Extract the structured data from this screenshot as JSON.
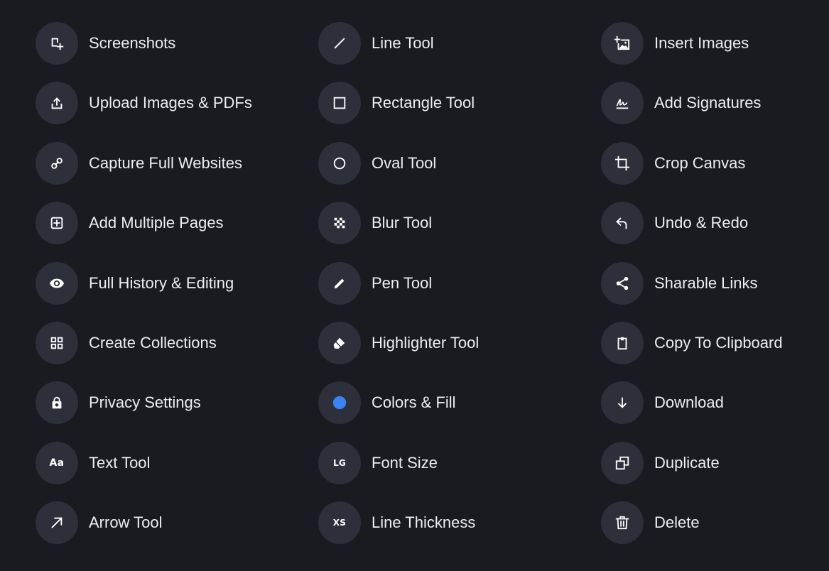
{
  "features": {
    "columns": [
      {
        "items": [
          {
            "label": "Screenshots",
            "icon": "screenshot-icon"
          },
          {
            "label": "Upload Images & PDFs",
            "icon": "upload-icon"
          },
          {
            "label": "Capture Full Websites",
            "icon": "link-icon"
          },
          {
            "label": "Add Multiple Pages",
            "icon": "add-page-icon"
          },
          {
            "label": "Full History & Editing",
            "icon": "eye-icon"
          },
          {
            "label": "Create Collections",
            "icon": "grid-icon"
          },
          {
            "label": "Privacy Settings",
            "icon": "lock-icon"
          },
          {
            "label": "Text Tool",
            "icon": "text-icon",
            "glyph": "Aa"
          },
          {
            "label": "Arrow Tool",
            "icon": "arrow-icon"
          }
        ]
      },
      {
        "items": [
          {
            "label": "Line Tool",
            "icon": "line-icon"
          },
          {
            "label": "Rectangle Tool",
            "icon": "rectangle-icon"
          },
          {
            "label": "Oval Tool",
            "icon": "oval-icon"
          },
          {
            "label": "Blur Tool",
            "icon": "blur-icon"
          },
          {
            "label": "Pen Tool",
            "icon": "pen-icon"
          },
          {
            "label": "Highlighter Tool",
            "icon": "highlighter-icon"
          },
          {
            "label": "Colors & Fill",
            "icon": "color-dot-icon"
          },
          {
            "label": "Font Size",
            "icon": "font-size-icon",
            "glyph": "LG"
          },
          {
            "label": "Line Thickness",
            "icon": "line-thickness-icon",
            "glyph": "XS"
          }
        ]
      },
      {
        "items": [
          {
            "label": "Insert Images",
            "icon": "insert-image-icon"
          },
          {
            "label": "Add Signatures",
            "icon": "signature-icon"
          },
          {
            "label": "Crop Canvas",
            "icon": "crop-icon"
          },
          {
            "label": "Undo & Redo",
            "icon": "undo-icon"
          },
          {
            "label": "Sharable Links",
            "icon": "share-icon"
          },
          {
            "label": "Copy To Clipboard",
            "icon": "clipboard-icon"
          },
          {
            "label": "Download",
            "icon": "download-icon"
          },
          {
            "label": "Duplicate",
            "icon": "duplicate-icon"
          },
          {
            "label": "Delete",
            "icon": "trash-icon"
          }
        ]
      }
    ]
  },
  "colors": {
    "background": "#1a1b20",
    "icon_circle": "#2d303a",
    "accent_fill": "#3b82f6",
    "text": "#eceef1"
  }
}
